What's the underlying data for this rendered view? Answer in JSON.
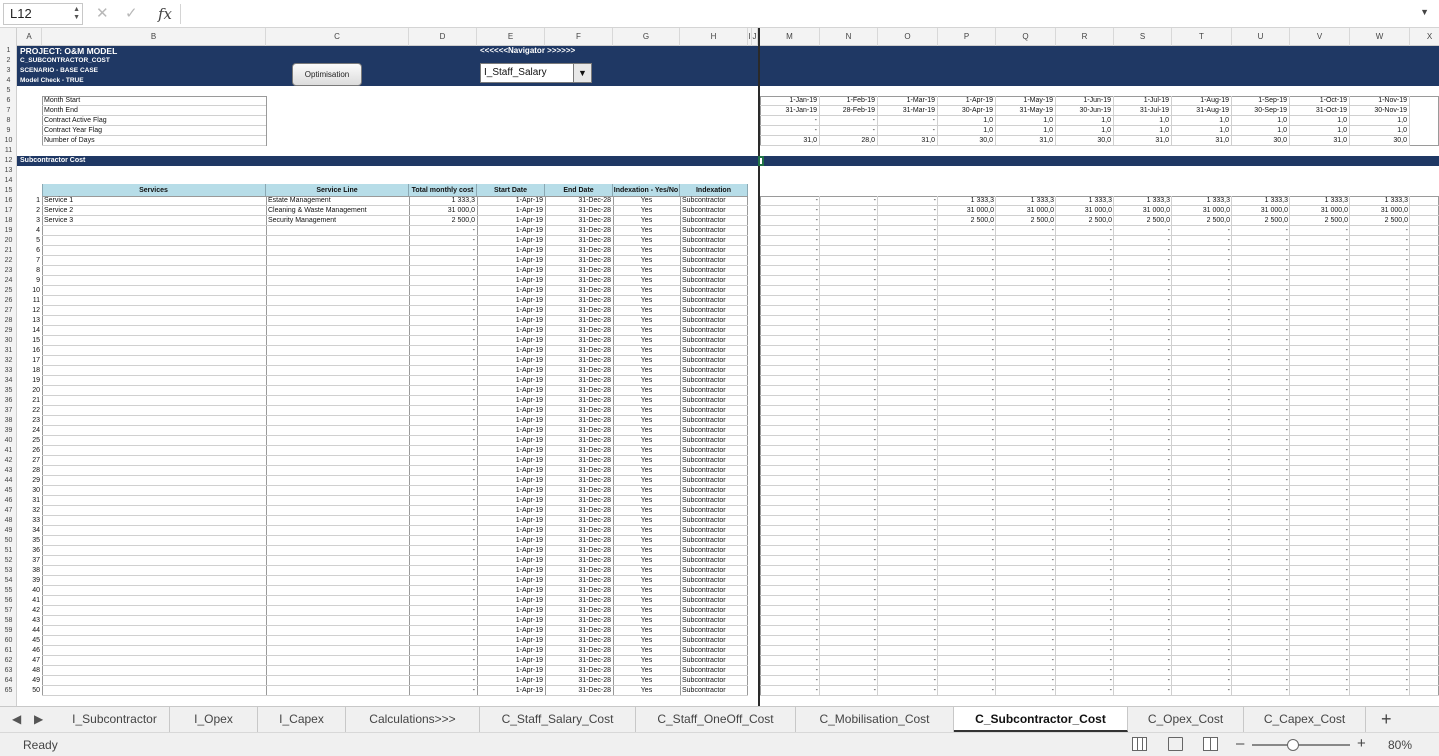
{
  "formula_bar": {
    "name_box": "L12",
    "cancel_icon": "x-icon",
    "confirm_icon": "check-icon",
    "fx_label": "fx",
    "formula": ""
  },
  "columns": [
    "A",
    "B",
    "C",
    "D",
    "E",
    "F",
    "G",
    "H",
    "I",
    "J",
    "L",
    "M",
    "N",
    "O",
    "P",
    "Q",
    "R",
    "S",
    "T",
    "U",
    "V",
    "W",
    "X"
  ],
  "banner": {
    "title": "PROJECT: O&M MODEL",
    "sheet": "C_SUBCONTRACTOR_COST",
    "scenario": "SCENARIO - BASE CASE",
    "model_check": "Model Check - TRUE",
    "navigator_label": "<<<<<<Navigator >>>>>>",
    "optimisation_button": "Optimisation",
    "navigator_selected": "I_Staff_Salary"
  },
  "timeline": {
    "labels": [
      "Month Start",
      "Month End",
      "Contract Active Flag",
      "Contract Year Flag",
      "Number of Days"
    ],
    "month_start": [
      "1-Jan-19",
      "1-Feb-19",
      "1-Mar-19",
      "1-Apr-19",
      "1-May-19",
      "1-Jun-19",
      "1-Jul-19",
      "1-Aug-19",
      "1-Sep-19",
      "1-Oct-19",
      "1-Nov-19"
    ],
    "month_end": [
      "31-Jan-19",
      "28-Feb-19",
      "31-Mar-19",
      "30-Apr-19",
      "31-May-19",
      "30-Jun-19",
      "31-Jul-19",
      "31-Aug-19",
      "30-Sep-19",
      "31-Oct-19",
      "30-Nov-19"
    ],
    "active_flag": [
      "-",
      "-",
      "-",
      "1,0",
      "1,0",
      "1,0",
      "1,0",
      "1,0",
      "1,0",
      "1,0",
      "1,0"
    ],
    "year_flag": [
      "-",
      "-",
      "-",
      "1,0",
      "1,0",
      "1,0",
      "1,0",
      "1,0",
      "1,0",
      "1,0",
      "1,0"
    ],
    "days": [
      "31,0",
      "28,0",
      "31,0",
      "30,0",
      "31,0",
      "30,0",
      "31,0",
      "31,0",
      "30,0",
      "31,0",
      "30,0"
    ]
  },
  "section_title": "Subcontractor Cost",
  "table": {
    "headers": [
      "Services",
      "Service Line",
      "Total monthly cost",
      "Start Date",
      "End Date",
      "Indexation - Yes/No",
      "Indexation"
    ],
    "rows": [
      {
        "n": "1",
        "service": "Service 1",
        "line": "Estate Management",
        "cost": "1 333,3"
      },
      {
        "n": "2",
        "service": "Service 2",
        "line": "Cleaning & Waste Management",
        "cost": "31 000,0"
      },
      {
        "n": "3",
        "service": "Service 3",
        "line": "Security Management",
        "cost": "2 500,0"
      }
    ],
    "empty_cost": "-",
    "start_date": "1-Apr-19",
    "end_date": "31-Dec-28",
    "indexation_yes_no": "Yes",
    "indexation": "Subcontractor",
    "monthly_values": [
      [
        "-",
        "-",
        "-",
        "1 333,3",
        "1 333,3",
        "1 333,3",
        "1 333,3",
        "1 333,3",
        "1 333,3",
        "1 333,3",
        "1 333,3"
      ],
      [
        "-",
        "-",
        "-",
        "31 000,0",
        "31 000,0",
        "31 000,0",
        "31 000,0",
        "31 000,0",
        "31 000,0",
        "31 000,0",
        "31 000,0"
      ],
      [
        "-",
        "-",
        "-",
        "2 500,0",
        "2 500,0",
        "2 500,0",
        "2 500,0",
        "2 500,0",
        "2 500,0",
        "2 500,0",
        "2 500,0"
      ]
    ]
  },
  "sheet_tabs": [
    "I_Subcontractor",
    "I_Opex",
    "I_Capex",
    "Calculations>>>",
    "C_Staff_Salary_Cost",
    "C_Staff_OneOff_Cost",
    "C_Mobilisation_Cost",
    "C_Subcontractor_Cost",
    "C_Opex_Cost",
    "C_Capex_Cost"
  ],
  "active_tab": "C_Subcontractor_Cost",
  "status": {
    "text": "Ready",
    "zoom": "80%"
  }
}
